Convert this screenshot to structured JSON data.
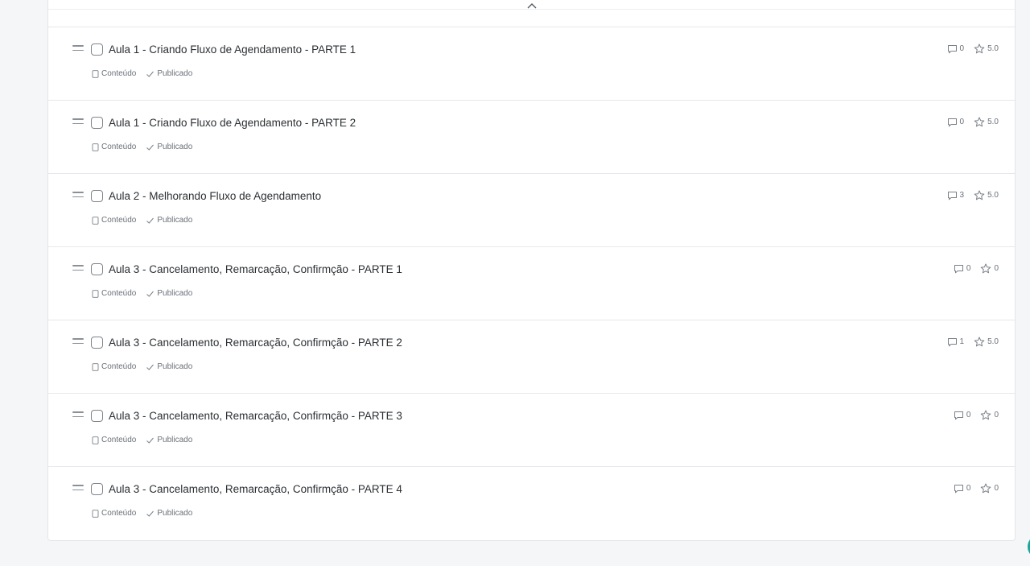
{
  "lessons": [
    {
      "title": "Aula 1 - Criando Fluxo de Agendamento - PARTE 1",
      "content_label": "Conteúdo",
      "status_label": "Publicado",
      "comments": "0",
      "rating": "5.0"
    },
    {
      "title": "Aula 1 - Criando Fluxo de Agendamento - PARTE 2",
      "content_label": "Conteúdo",
      "status_label": "Publicado",
      "comments": "0",
      "rating": "5.0"
    },
    {
      "title": "Aula 2 - Melhorando Fluxo de Agendamento",
      "content_label": "Conteúdo",
      "status_label": "Publicado",
      "comments": "3",
      "rating": "5.0"
    },
    {
      "title": "Aula 3 - Cancelamento, Remarcação, Confirmção - PARTE 1",
      "content_label": "Conteúdo",
      "status_label": "Publicado",
      "comments": "0",
      "rating": "0"
    },
    {
      "title": "Aula 3 - Cancelamento, Remarcação, Confirmção - PARTE 2",
      "content_label": "Conteúdo",
      "status_label": "Publicado",
      "comments": "1",
      "rating": "5.0"
    },
    {
      "title": "Aula 3 - Cancelamento, Remarcação, Confirmção - PARTE 3",
      "content_label": "Conteúdo",
      "status_label": "Publicado",
      "comments": "0",
      "rating": "0"
    },
    {
      "title": "Aula 3 - Cancelamento, Remarcação, Confirmção - PARTE 4",
      "content_label": "Conteúdo",
      "status_label": "Publicado",
      "comments": "0",
      "rating": "0"
    }
  ],
  "icons": {
    "collapse": "chevron-up-icon",
    "drag": "drag-handle-icon",
    "content": "document-icon",
    "status": "check-icon",
    "comments": "comment-icon",
    "rating": "star-icon"
  },
  "colors": {
    "background": "#f5f6f7",
    "panel": "#ffffff",
    "text": "#2b2f33",
    "muted": "#6b7178",
    "border": "#e6e8eb",
    "fab": "#1aa69a"
  }
}
